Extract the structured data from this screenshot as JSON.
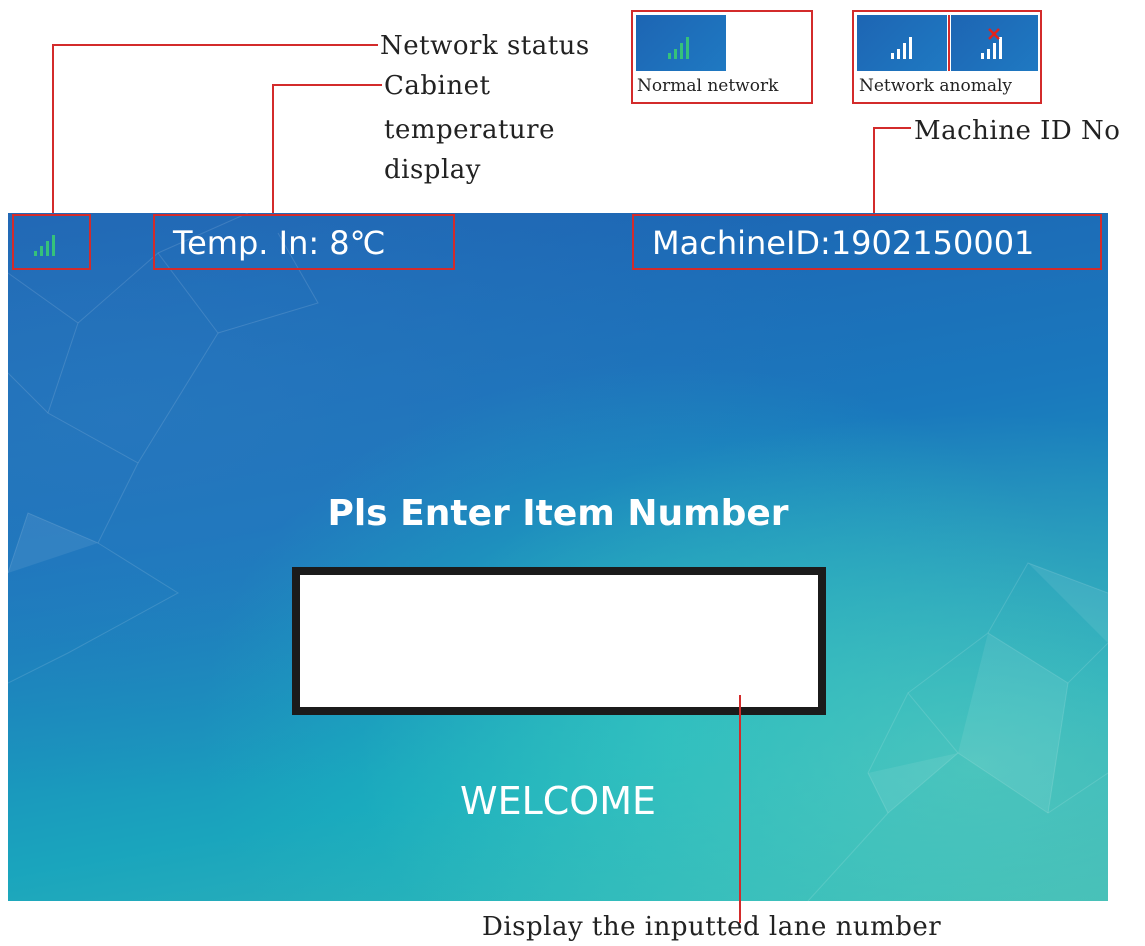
{
  "annotations": {
    "network_status": "Network status",
    "cabinet_temp_line1": "Cabinet",
    "cabinet_temp_line2": "temperature",
    "cabinet_temp_line3": "display",
    "machine_id": "Machine ID No",
    "lane_number": "Display the inputted lane number"
  },
  "legend": {
    "normal_caption": "Normal network",
    "anomaly_caption": "Network anomaly",
    "normal_icon": "signal-bars-icon",
    "anomaly_icon": "signal-bars-with-red-x-icon"
  },
  "screen": {
    "temperature_text": "Temp.  In:  8℃",
    "machine_id_text": "MachineID:1902150001",
    "prompt": "Pls Enter Item Number",
    "input_value": "",
    "welcome": "WELCOME",
    "network_icon": "signal-bars-icon"
  },
  "colors": {
    "annotation_red": "#d32b2b",
    "signal_green": "#35c27a",
    "screen_blue": "#1f5fb0",
    "screen_teal": "#1aa5bd"
  }
}
